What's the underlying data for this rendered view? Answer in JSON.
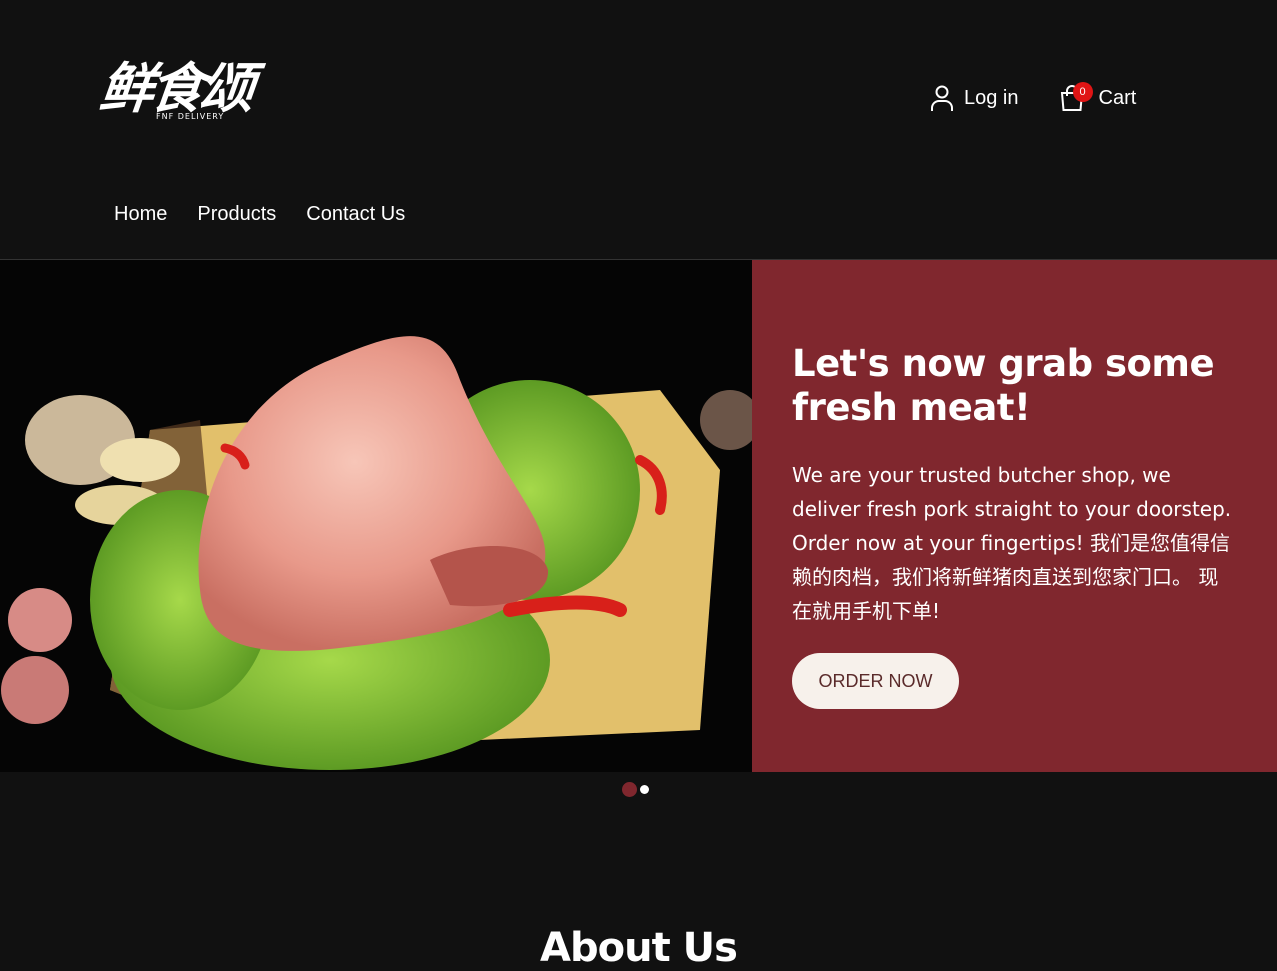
{
  "brand": {
    "logo_text": "鲜食颂",
    "logo_subtext": "FNF DELIVERY"
  },
  "header": {
    "login_label": "Log in",
    "cart_label": "Cart",
    "cart_count": "0"
  },
  "nav": {
    "items": [
      {
        "label": "Home"
      },
      {
        "label": "Products"
      },
      {
        "label": "Contact Us"
      }
    ]
  },
  "hero": {
    "title": "Let's now grab some fresh meat!",
    "text": "We are your trusted butcher shop, we deliver fresh pork straight to your doorstep. Order now at your fingertips! 我们是您值得信赖的肉档，我们将新鲜猪肉直送到您家门口。 现在就用手机下单!",
    "button_label": "ORDER NOW",
    "panel_color": "#80272e"
  },
  "carousel": {
    "slide_count": 2,
    "active_index": 0
  },
  "about": {
    "title": "About Us"
  },
  "icons": {
    "login": "user-icon",
    "cart": "shopping-bag-icon"
  }
}
